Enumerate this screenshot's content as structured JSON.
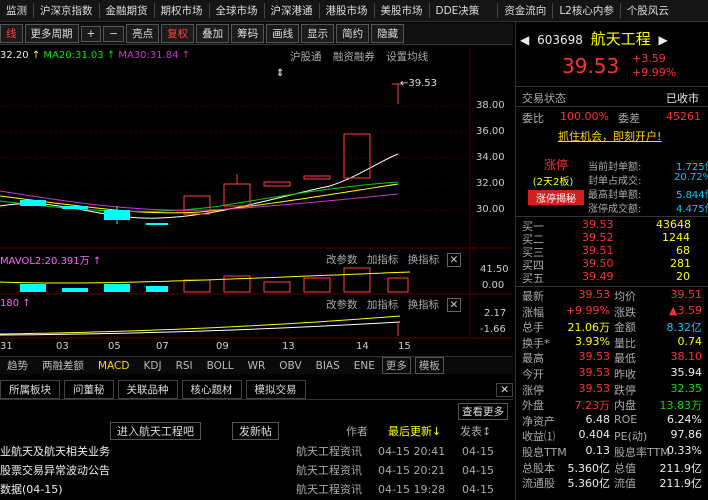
{
  "menu": [
    "监测",
    "沪深京指数",
    "金融期货",
    "期权市场",
    "全球市场",
    "沪深港通",
    "港股市场",
    "美股市场",
    "DDE决策",
    "资金流向",
    "L2核心内参",
    "个股风云"
  ],
  "toolbar": {
    "left_label": "线",
    "period": "更多周期",
    "plus": "+",
    "minus": "−",
    "highlight": "亮点",
    "restore": "复权",
    "overlay": "叠加",
    "chip": "筹码",
    "draw": "画线",
    "display": "显示",
    "brief": "简约",
    "hide": "隐藏"
  },
  "ma_legend": {
    "ma10": "32.20",
    "ma20": "MA20:31.03",
    "ma30": "MA30:31.84"
  },
  "chart_links": [
    "沪股通",
    "融资融券",
    "设置均线"
  ],
  "price_axis": [
    "38.00",
    "36.00",
    "34.00",
    "32.00",
    "30.00"
  ],
  "max_label": "39.53",
  "vol_legend": "MAVOL2:20.391万",
  "vol_axis": [
    "41.50",
    "0.00"
  ],
  "macd_legend": "180",
  "macd_axis": [
    "2.17",
    "-1.66"
  ],
  "sub_links": [
    "改参数",
    "加指标",
    "换指标"
  ],
  "date_ticks": [
    "31",
    "03",
    "05",
    "07",
    "09",
    "13",
    "14",
    "15"
  ],
  "indicator_tabs": [
    "趋势",
    "两融差额",
    "MACD",
    "KDJ",
    "RSI",
    "BOLL",
    "WR",
    "OBV",
    "BIAS",
    "ENE",
    "更多",
    "模板"
  ],
  "news_tabs": [
    "所属板块",
    "问董秘",
    "关联品种",
    "核心题材",
    "模拟交易"
  ],
  "news_more": "查看更多",
  "news_header": {
    "enter": "进入航天工程吧",
    "post": "发新帖",
    "author": "作者",
    "latest": "最后更新↓",
    "time": "发表↕"
  },
  "news": [
    {
      "title": "业航天及航天相关业务",
      "author": "航天工程资讯",
      "updated": "04-15 20:41",
      "posted": "04-15"
    },
    {
      "title": "股票交易异常波动公告",
      "author": "航天工程资讯",
      "updated": "04-15 20:21",
      "posted": "04-15"
    },
    {
      "title": "数据(04-15)",
      "author": "航天工程资讯",
      "updated": "04-15 19:28",
      "posted": "04-15"
    }
  ],
  "stock": {
    "code": "603698",
    "name": "航天工程",
    "price": "39.53",
    "change": "+3.59",
    "pct": "+9.99%"
  },
  "status": {
    "label": "交易状态",
    "value": "已收市"
  },
  "weibi": {
    "label": "委比",
    "value": "100.00%",
    "label2": "委差",
    "value2": "45261"
  },
  "promo": "抓住机会，即刻开户!",
  "limit_up": {
    "badge": "涨停",
    "board": "(2天2板)",
    "reveal": "涨停揭秘",
    "rows": [
      {
        "k": "当前封单额:",
        "v": "1.725亿"
      },
      {
        "k": "封单占成交:",
        "v": "20.72%"
      },
      {
        "k": "最高封单额:",
        "v": "5.844亿"
      },
      {
        "k": "涨停成交额:",
        "v": "4.475亿"
      }
    ]
  },
  "orderbook": [
    {
      "level": "买一",
      "price": "39.53",
      "vol": "43648"
    },
    {
      "level": "买二",
      "price": "39.52",
      "vol": "1244"
    },
    {
      "level": "买三",
      "price": "39.51",
      "vol": "68"
    },
    {
      "level": "买四",
      "price": "39.50",
      "vol": "281"
    },
    {
      "level": "买五",
      "price": "39.49",
      "vol": "20"
    }
  ],
  "quote": [
    {
      "k1": "最新",
      "v1": "39.53",
      "c1": "red",
      "k2": "均价",
      "v2": "39.51",
      "c2": "red"
    },
    {
      "k1": "涨幅",
      "v1": "+9.99%",
      "c1": "red",
      "k2": "涨跌",
      "v2": "▲3.59",
      "c2": "red"
    },
    {
      "k1": "总手",
      "v1": "21.06万",
      "c1": "yellow",
      "k2": "金额",
      "v2": "8.32亿",
      "c2": "cyan"
    },
    {
      "k1": "换手*",
      "v1": "3.93%",
      "c1": "yellow",
      "k2": "量比",
      "v2": "0.74",
      "c2": "yellow"
    },
    {
      "k1": "最高",
      "v1": "39.53",
      "c1": "red",
      "k2": "最低",
      "v2": "38.10",
      "c2": "red"
    },
    {
      "k1": "今开",
      "v1": "39.53",
      "c1": "red",
      "k2": "昨收",
      "v2": "35.94",
      "c2": "white"
    },
    {
      "k1": "涨停",
      "v1": "39.53",
      "c1": "red",
      "k2": "跌停",
      "v2": "32.35",
      "c2": "green"
    },
    {
      "k1": "外盘",
      "v1": "7.23万",
      "c1": "red",
      "k2": "内盘",
      "v2": "13.83万",
      "c2": "green"
    },
    {
      "k1": "净资产",
      "v1": "6.48",
      "c1": "white",
      "k2": "ROE",
      "v2": "6.24%",
      "c2": "white"
    },
    {
      "k1": "收益⑴",
      "v1": "0.404",
      "c1": "white",
      "k2": "PE(动)",
      "v2": "97.86",
      "c2": "white"
    },
    {
      "k1": "股息TTM",
      "v1": "0.13",
      "c1": "white",
      "k2": "股息率TTM",
      "v2": "0.33%",
      "c2": "white"
    },
    {
      "k1": "总股本",
      "v1": "5.360亿",
      "c1": "white",
      "k2": "总值",
      "v2": "211.9亿",
      "c2": "white"
    },
    {
      "k1": "流通股",
      "v1": "5.360亿",
      "c1": "white",
      "k2": "流值",
      "v2": "211.9亿",
      "c2": "white"
    }
  ]
}
